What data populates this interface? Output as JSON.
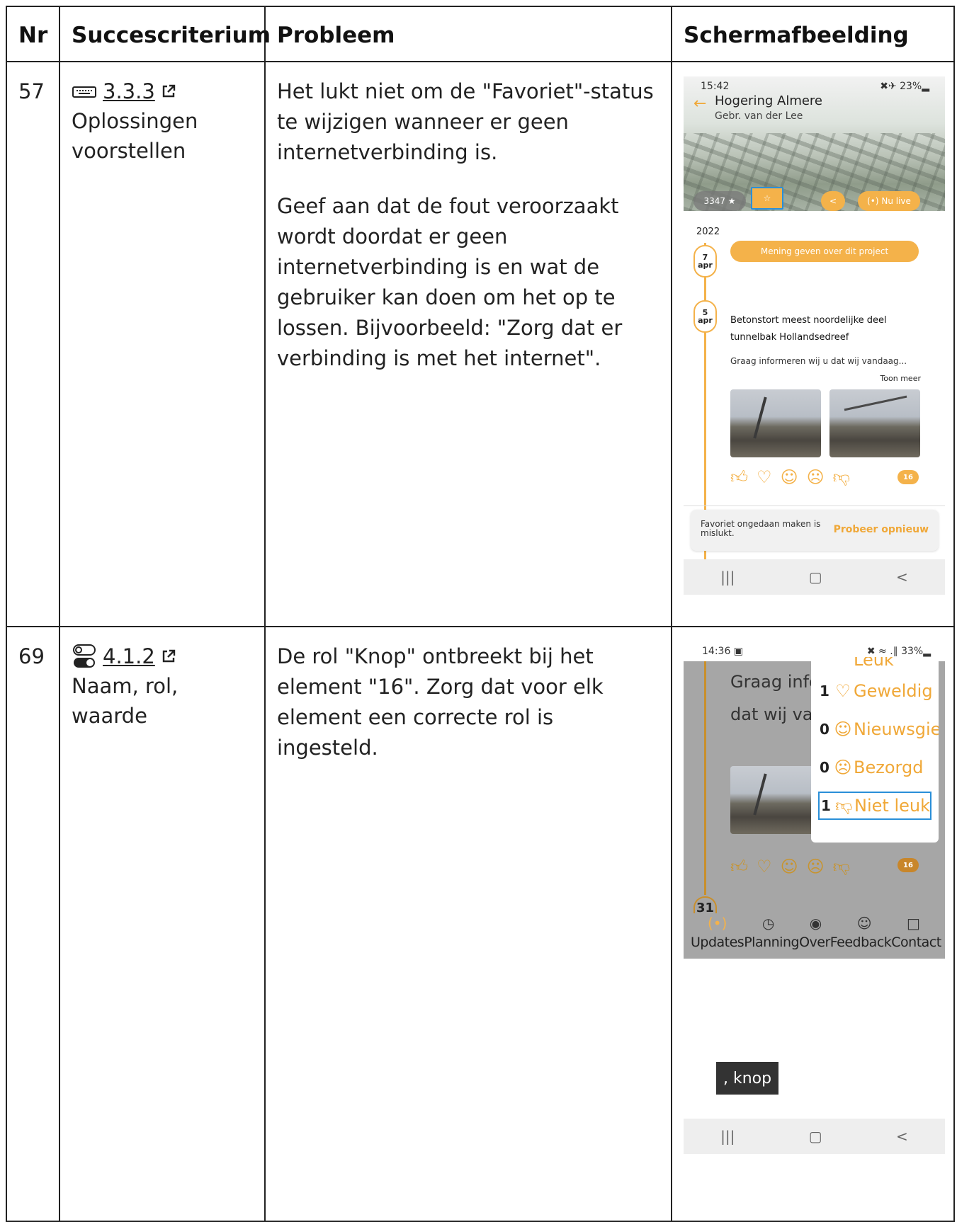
{
  "table": {
    "headers": [
      "Nr",
      "Succescriterium",
      "Probleem",
      "Schermafbeelding"
    ],
    "rows": [
      {
        "nr": "57",
        "criterion_icon": "keyboard-icon",
        "criterion_link": "3.3.3",
        "criterion_name": "Oplossingen voorstellen",
        "problem": [
          "Het lukt niet om de \"Favoriet\"-status te wijzigen wanneer er geen internetverbinding is.",
          "Geef aan dat de fout veroorzaakt wordt doordat er geen internetverbinding is en wat de gebruiker kan doen om het op te lossen. Bijvoorbeeld: \"Zorg dat er verbinding is met het internet\"."
        ],
        "screenshot": {
          "time": "15:42",
          "sys": "✖✈ 23%▂",
          "title": "Hogering Almere",
          "subtitle": "Gebr. van der Lee",
          "count": "3347 ★",
          "live": "(•) Nu live",
          "year": "2022",
          "date1_day": "7",
          "date1_month": "apr",
          "date2_day": "5",
          "date2_month": "apr",
          "opinion_button": "Mening geven over dit project",
          "post_title": "Betonstort meest noordelijke deel tunnelbak Hollandsedreef",
          "post_text": "Graag informeren wij u dat wij vandaag...",
          "more": "Toon meer",
          "badge": "16",
          "snack_message": "Favoriet ongedaan maken is mislukt.",
          "snack_action": "Probeer opnieuw"
        }
      },
      {
        "nr": "69",
        "criterion_icon": "toggle-icon",
        "criterion_link": "4.1.2",
        "criterion_name": "Naam, rol, waarde",
        "problem": [
          "De rol \"Knop\" ontbreekt bij het element \"16\". Zorg dat voor elk element een correcte rol is ingesteld."
        ],
        "screenshot": {
          "time": "14:36 ▣",
          "sys": "✖ ≈ .∥ 33%▂",
          "bg_line1": "Graag info",
          "bg_line2": "dat wij var",
          "badge": "16",
          "date_day": "31",
          "popup": [
            {
              "count": "1",
              "label": "Geweldig"
            },
            {
              "count": "0",
              "label": "Nieuwsgie"
            },
            {
              "count": "0",
              "label": "Bezorgd"
            },
            {
              "count": "1",
              "label": "Niet leuk"
            }
          ],
          "popup_top": "Leuk",
          "nav": [
            "Updates",
            "Planning",
            "Over",
            "Feedback",
            "Contact"
          ],
          "tooltip": ", knop"
        }
      }
    ]
  }
}
